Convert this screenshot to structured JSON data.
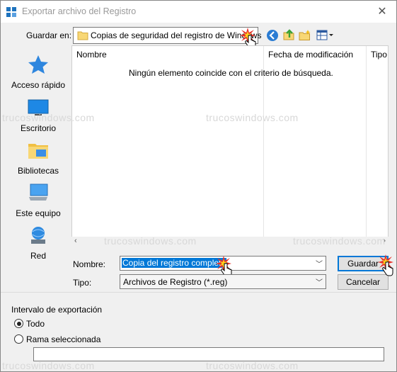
{
  "window": {
    "title": "Exportar archivo del Registro",
    "close_glyph": "✕"
  },
  "save_in": {
    "label": "Guardar en:",
    "value": "Copias de seguridad del registro de Windows"
  },
  "places": [
    {
      "label": "Acceso rápido",
      "icon": "star-icon"
    },
    {
      "label": "Escritorio",
      "icon": "desktop-icon"
    },
    {
      "label": "Bibliotecas",
      "icon": "libraries-icon"
    },
    {
      "label": "Este equipo",
      "icon": "computer-icon"
    },
    {
      "label": "Red",
      "icon": "network-icon"
    }
  ],
  "filelist": {
    "columns": [
      "Nombre",
      "Fecha de modificación",
      "Tipo"
    ],
    "empty_message": "Ningún elemento coincide con el criterio de búsqueda."
  },
  "filename": {
    "label": "Nombre:",
    "value": "Copia del registro completa"
  },
  "filetype": {
    "label": "Tipo:",
    "value": "Archivos de Registro (*.reg)"
  },
  "buttons": {
    "save": "Guardar",
    "cancel": "Cancelar"
  },
  "export_range": {
    "title": "Intervalo de exportación",
    "all_label": "Todo",
    "branch_label": "Rama seleccionada",
    "branch_value": ""
  },
  "watermark": "truco s windows .com",
  "watermark_text": "trucoswindows.com",
  "colors": {
    "accent": "#0078d7",
    "selection": "#0078d7"
  }
}
